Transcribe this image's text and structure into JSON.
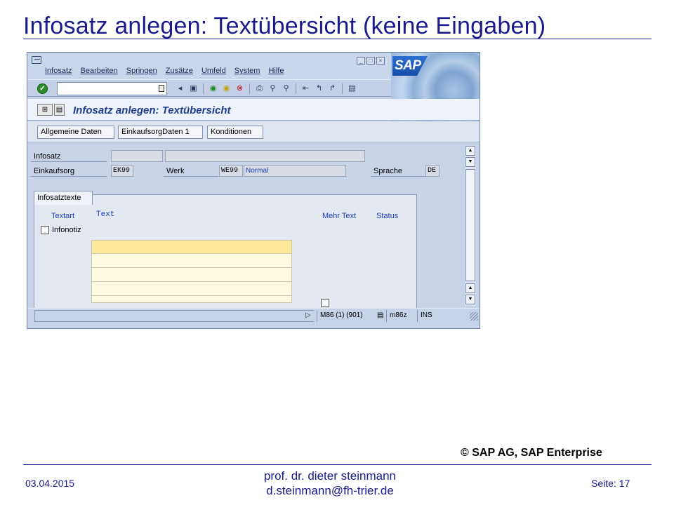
{
  "slide": {
    "title": "Infosatz anlegen: Textübersicht (keine Eingaben)",
    "copyright": "© SAP AG, SAP Enterprise",
    "date": "03.04.2015",
    "author_line1": "prof. dr. dieter steinmann",
    "author_line2": "d.steinmann@fh-trier.de",
    "page_label": "Seite: 17"
  },
  "sap": {
    "menu": [
      "Infosatz",
      "Bearbeiten",
      "Springen",
      "Zusätze",
      "Umfeld",
      "System",
      "Hilfe"
    ],
    "logo_text": "SAP",
    "command_value": "",
    "screen_title": "Infosatz anlegen: Textübersicht",
    "app_buttons": [
      "Allgemeine Daten",
      "EinkaufsorgDaten 1",
      "Konditionen"
    ],
    "fields": {
      "infosatz_label": "Infosatz",
      "infosatz_value": "",
      "einkaufsorg_label": "Einkaufsorg",
      "einkaufsorg_value": "EK99",
      "werk_label": "Werk",
      "werk_value": "WE99",
      "werk_type": "Normal",
      "sprache_label": "Sprache",
      "sprache_value": "DE"
    },
    "tab": {
      "label": "Infosatztexte",
      "col_textart": "Textart",
      "col_text": "Text",
      "col_mehr_text": "Mehr Text",
      "col_status": "Status",
      "row_label": "Infonotiz"
    },
    "status": {
      "system": "M86 (1) (901)",
      "server": "m86z",
      "mode": "INS"
    },
    "icons": [
      "ok-icon",
      "save-icon",
      "back-icon",
      "exit-icon",
      "cancel-icon",
      "print-icon",
      "find-icon",
      "find-next-icon",
      "first-page-icon",
      "prev-page-icon",
      "next-page-icon",
      "last-page-icon",
      "new-session-icon"
    ]
  }
}
